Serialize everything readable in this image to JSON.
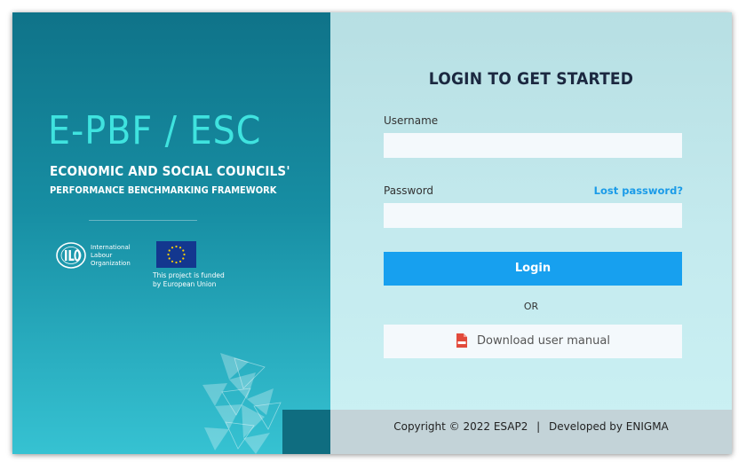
{
  "brand": {
    "title": "E-PBF / ESC",
    "tagline": "ECONOMIC AND SOCIAL COUNCILS'",
    "subtitle": "PERFORMANCE BENCHMARKING FRAMEWORK"
  },
  "partners": {
    "ilo_name_1": "International",
    "ilo_name_2": "Labour",
    "ilo_name_3": "Organization",
    "eu_note_1": "This project is funded",
    "eu_note_2": "by European Union"
  },
  "login": {
    "heading": "LOGIN TO GET STARTED",
    "username_label": "Username",
    "username_value": "",
    "password_label": "Password",
    "password_value": "",
    "lost_password": "Lost password?",
    "login_button": "Login",
    "or_text": "OR",
    "download_button": "Download user manual"
  },
  "footer": {
    "copyright": "Copyright © 2022 ESAP2",
    "separator": "|",
    "developer": "Developed by ENIGMA"
  },
  "icons": {
    "pdf": "pdf-file-icon",
    "ilo": "ilo-logo",
    "eu": "eu-flag"
  },
  "colors": {
    "accent": "#17a0ef",
    "brand_cyan": "#3fe3df",
    "left_panel_top": "#0f7389",
    "left_panel_bottom": "#36c2d2",
    "right_panel": "#c4eaee",
    "heading": "#1b2840"
  }
}
